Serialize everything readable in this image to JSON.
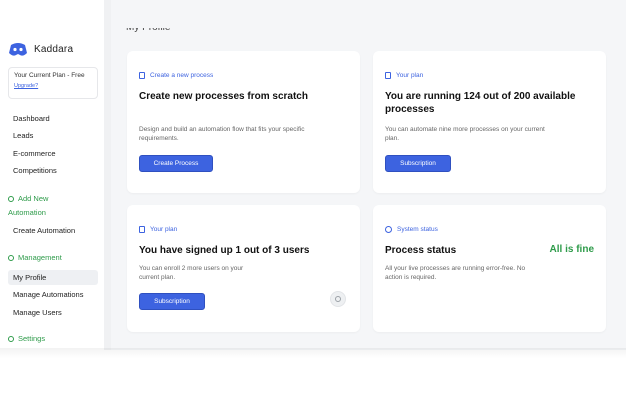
{
  "brand": {
    "name": "Kaddara",
    "accent": "#3d63e0"
  },
  "plan": {
    "text": "Your Current Plan - Free",
    "upgrade": "Upgrade?"
  },
  "nav": {
    "items": [
      "Dashboard",
      "Leads",
      "E-commerce",
      "Competitions"
    ],
    "add_section": "Add New Automation",
    "add_items": [
      "Create Automation"
    ],
    "management_section": "Management",
    "management_items": [
      "My Profile",
      "Manage Automations",
      "Manage Users"
    ],
    "settings_section": "Settings",
    "active": "My Profile"
  },
  "page": {
    "title": "My Profile"
  },
  "cards": {
    "create": {
      "tag": "Create a new process",
      "title": "Create new processes from scratch",
      "desc": "Design and build an automation flow that fits your specific requirements.",
      "button": "Create Process"
    },
    "plan_processes": {
      "tag": "Your plan",
      "title": "You are running 124 out of 200 available processes",
      "desc": "You can automate nine more processes on your current plan.",
      "button": "Subscription"
    },
    "plan_users": {
      "tag": "Your plan",
      "title": "You have signed up 1 out of 3 users",
      "desc": "You can enroll 2 more users on your current plan.",
      "button": "Subscription"
    },
    "status": {
      "tag": "System status",
      "title": "Process status",
      "status": "All is fine",
      "desc": "All your live processes are running error-free. No action is required."
    }
  },
  "colors": {
    "primary": "#3d63e0",
    "success": "#2e9b4a",
    "background": "#f5f6f8"
  }
}
